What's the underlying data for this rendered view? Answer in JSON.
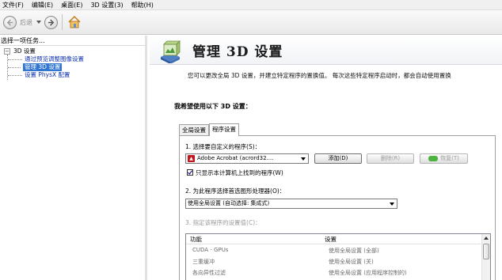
{
  "menu": [
    "文件(F)",
    "编辑(E)",
    "桌面(E)",
    "3D 设置(3)",
    "帮助(H)"
  ],
  "toolbar": {
    "back_label": "后退"
  },
  "sidebar": {
    "title": "选择一项任务...",
    "root": "3D 设置",
    "items": [
      {
        "label": "通过预览调整图像设置",
        "selected": false
      },
      {
        "label": "管理 3D 设置",
        "selected": true
      },
      {
        "label": "设置 PhysX 配置",
        "selected": false
      }
    ]
  },
  "main": {
    "title": "管理 3D 设置",
    "description": "您可以更改全局 3D 设置，并建立特定程序的置换值。 每次这些特定程序启动时，都会自动使用置换",
    "section_heading": "我希望使用以下 3D 设置：",
    "tabs": [
      {
        "label": "全局设置",
        "active": false
      },
      {
        "label": "程序设置",
        "active": true
      }
    ],
    "step1_label": "1. 选择要自定义的程序(S)：",
    "program_value": "Adobe Acrobat (acrord32....",
    "add_button": "添加(D)",
    "delete_button": "删除(R)",
    "restore_button": "恢复(T)",
    "checkbox_label": "只显示本计算机上找到的程序(W)",
    "checkbox_checked": true,
    "step2_label": "2. 为此程序选择首选图形处理器(O)：",
    "gpu_value": "使用全局设置 (自动选择: 集成式)",
    "step3_label": "3. 指定该程序的设置值(C)：",
    "list_headers": [
      "功能",
      "设置"
    ],
    "list_rows": [
      [
        "CUDA - GPUs",
        "使用全局设置 (全部)"
      ],
      [
        "三重缓冲",
        "使用全局设置 (关)"
      ],
      [
        "各向异性过滤",
        "使用全局设置 (应用程序控制的)"
      ]
    ]
  },
  "colors": {
    "selection": "#3276cf",
    "link": "#0d2fb0",
    "pdf_red": "#c3161c",
    "restore_green": "#4db443"
  }
}
